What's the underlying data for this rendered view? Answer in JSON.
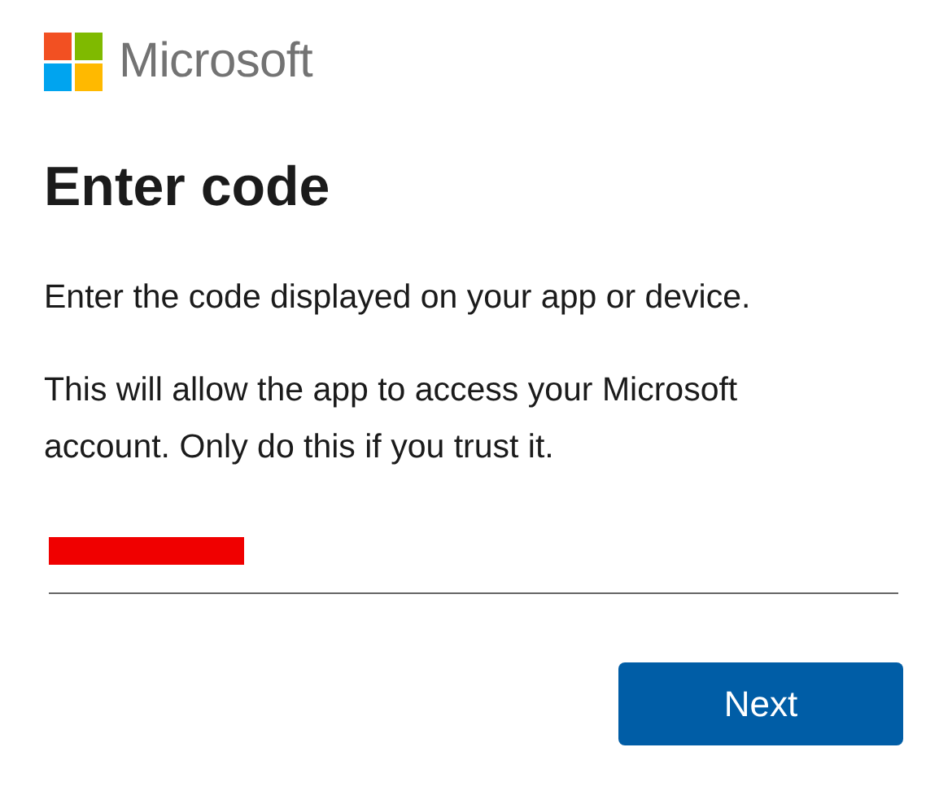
{
  "logo": {
    "text": "Microsoft"
  },
  "title": "Enter code",
  "paragraphs": [
    "Enter the code displayed on your app or device.",
    "This will allow the app to access your Microsoft account. Only do this if you trust it."
  ],
  "code_field": {
    "redacted": true
  },
  "buttons": [
    {
      "label": "Next",
      "kind": "primary"
    }
  ]
}
